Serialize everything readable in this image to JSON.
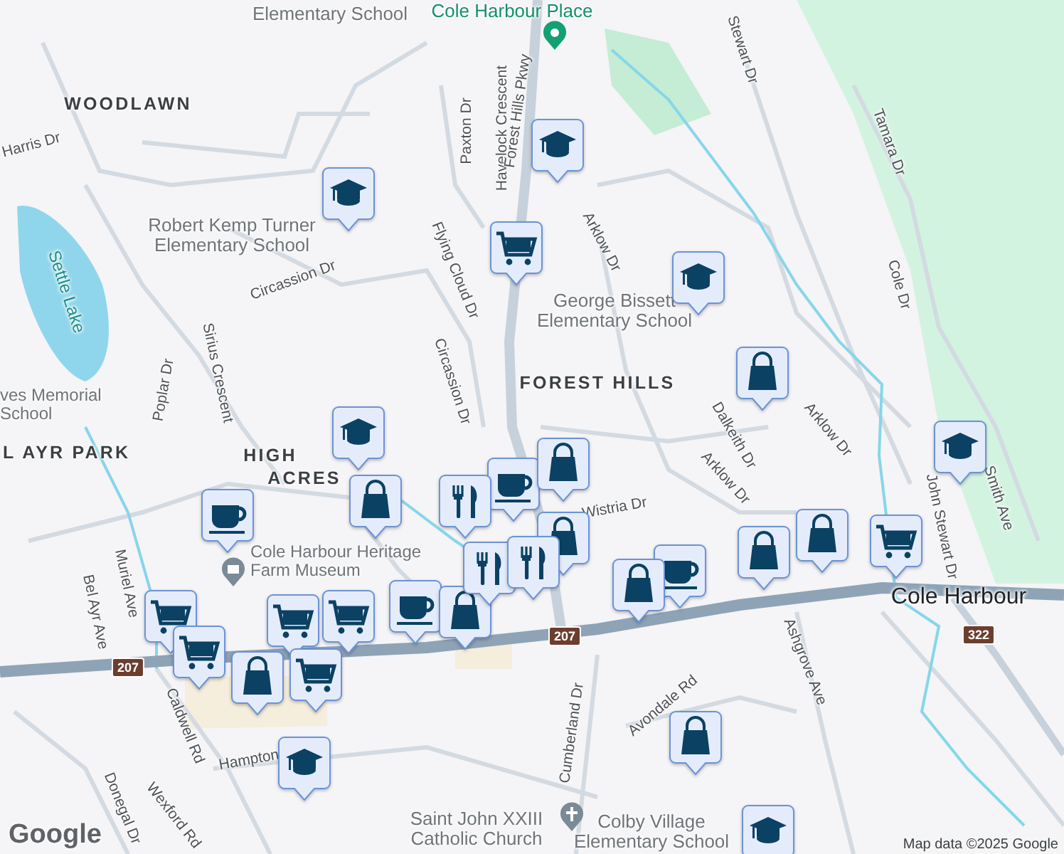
{
  "map": {
    "areas": [
      "WOODLAWN",
      "HIGH",
      "ACRES",
      "FOREST HILLS",
      "L AYR PARK"
    ],
    "town": "Cole Harbour",
    "places": [
      {
        "name": "Elementary School",
        "kind": "grey"
      },
      {
        "name": "Cole Harbour Place",
        "kind": "green"
      },
      {
        "name": "Robert Kemp Turner Elementary School",
        "kind": "grey"
      },
      {
        "name": "George Bissett Elementary School",
        "kind": "grey"
      },
      {
        "name": "ves Memorial School",
        "kind": "grey"
      },
      {
        "name": "Cole Harbour Heritage Farm Museum",
        "kind": "grey"
      },
      {
        "name": "Saint John XXIII Catholic Church",
        "kind": "grey"
      },
      {
        "name": "Colby Village Elementary School",
        "kind": "grey"
      }
    ],
    "streets": [
      "Harris Dr",
      "Paxton Dr",
      "Havelock Crescent",
      "Forest Hills Pkwy",
      "Flying Cloud Dr",
      "Circassion Dr",
      "Circassion Dr",
      "Sirius Crescent",
      "Poplar Dr",
      "Arklow Dr",
      "Stewart Dr",
      "Tamara Dr",
      "Cole Dr",
      "Arklow Dr",
      "Dalkeith Dr",
      "Arklow Dr",
      "Wistria Dr",
      "Smith Ave",
      "John Stewart Dr",
      "Muriel Ave",
      "Bel Ayr Ave",
      "Caldwell Rd",
      "Hampton",
      "Donegal Dr",
      "Wexford Rd",
      "Cumberland Dr",
      "Avondale Rd",
      "Ashgrove Ave"
    ],
    "water": [
      "Settle Lake"
    ],
    "route_shields": [
      "207",
      "207",
      "322"
    ],
    "pins": [
      {
        "kind": "school"
      },
      {
        "kind": "school"
      },
      {
        "kind": "school"
      },
      {
        "kind": "school"
      },
      {
        "kind": "school"
      },
      {
        "kind": "school"
      },
      {
        "kind": "school"
      },
      {
        "kind": "cart"
      },
      {
        "kind": "cart"
      },
      {
        "kind": "cart"
      },
      {
        "kind": "cart"
      },
      {
        "kind": "cart"
      },
      {
        "kind": "cart"
      },
      {
        "kind": "cart"
      },
      {
        "kind": "cafe"
      },
      {
        "kind": "cafe"
      },
      {
        "kind": "cafe"
      },
      {
        "kind": "cafe"
      },
      {
        "kind": "shop"
      },
      {
        "kind": "shop"
      },
      {
        "kind": "shop"
      },
      {
        "kind": "shop"
      },
      {
        "kind": "shop"
      },
      {
        "kind": "shop"
      },
      {
        "kind": "shop"
      },
      {
        "kind": "shop"
      },
      {
        "kind": "shop"
      },
      {
        "kind": "shop"
      },
      {
        "kind": "food"
      },
      {
        "kind": "food"
      },
      {
        "kind": "food"
      }
    ],
    "logo": "Google",
    "attribution": "Map data ©2025 Google"
  }
}
